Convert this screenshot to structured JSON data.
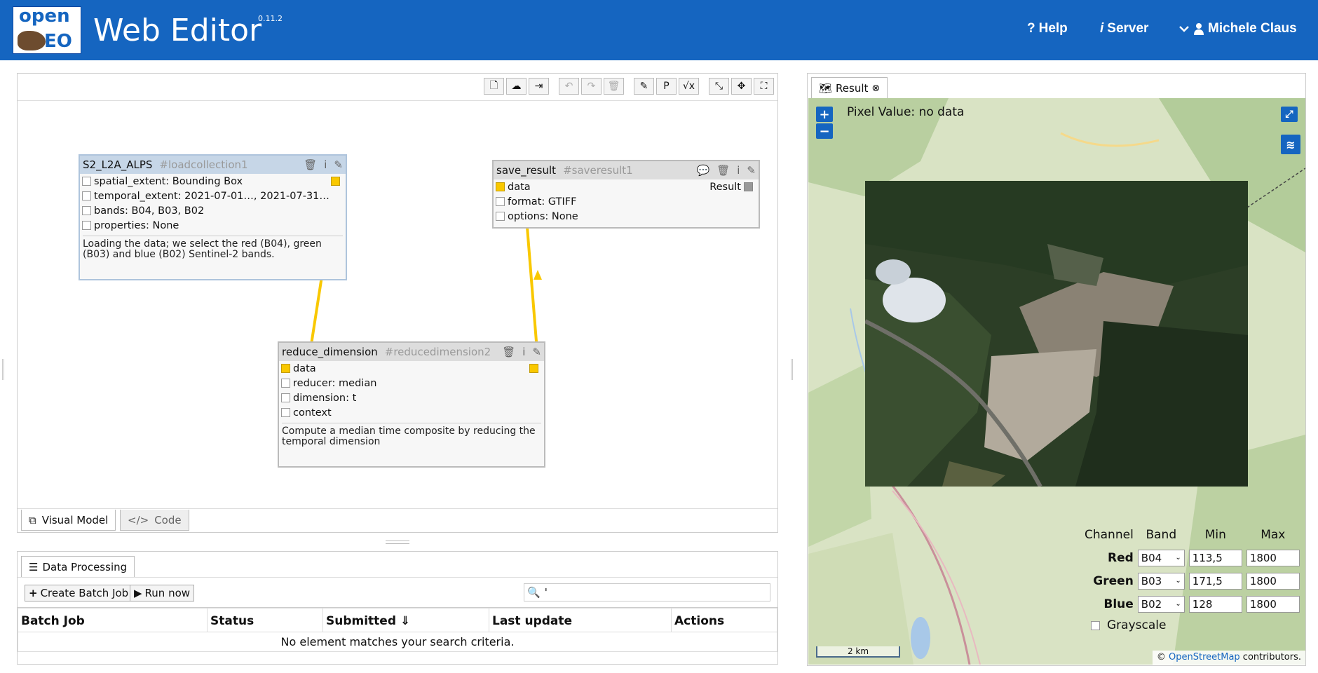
{
  "header": {
    "logo_top": "open",
    "logo_bottom": "EO",
    "title": "Web Editor",
    "version": "0.11.2",
    "help": "Help",
    "server": "Server",
    "user": "Michele Claus"
  },
  "nodes": {
    "load": {
      "name": "S2_L2A_ALPS",
      "id": "#loadcollection1",
      "params": [
        "spatial_extent: Bounding Box",
        "temporal_extent: 2021-07-01…, 2021-07-31…",
        "bands: B04, B03, B02",
        "properties: None"
      ],
      "description": "Loading the data; we select the red (B04), green (B03) and blue (B02) Sentinel-2 bands."
    },
    "save": {
      "name": "save_result",
      "id": "#saveresult1",
      "params": [
        "data",
        "format: GTIFF",
        "options: None"
      ],
      "result_label": "Result"
    },
    "reduce": {
      "name": "reduce_dimension",
      "id": "#reducedimension2",
      "params": [
        "data",
        "reducer: median",
        "dimension: t",
        "context"
      ],
      "description": "Compute a median time composite by reducing the temporal dimension"
    }
  },
  "editor_tabs": {
    "visual": "Visual Model",
    "code": "Code"
  },
  "data_processing": {
    "tab": "Data Processing",
    "create_batch": "Create Batch Job",
    "run_now": "Run now",
    "search_value": "'",
    "columns": [
      "Batch Job",
      "Status",
      "Submitted ⇓",
      "Last update",
      "Actions"
    ],
    "empty_message": "No element matches your search criteria."
  },
  "result": {
    "tab": "Result",
    "pixel_value": "Pixel Value: no data",
    "zoom_in": "+",
    "zoom_out": "−",
    "channels": {
      "headers": [
        "Channel",
        "Band",
        "Min",
        "Max"
      ],
      "rows": [
        {
          "channel": "Red",
          "band": "B04",
          "min": "113,5",
          "max": "1800"
        },
        {
          "channel": "Green",
          "band": "B03",
          "min": "171,5",
          "max": "1800"
        },
        {
          "channel": "Blue",
          "band": "B02",
          "min": "128",
          "max": "1800"
        }
      ],
      "grayscale": "Grayscale"
    },
    "scale": "2 km",
    "attribution_prefix": "© ",
    "attribution_link": "OpenStreetMap",
    "attribution_suffix": " contributors."
  },
  "colors": {
    "header": "#1565c0",
    "port": "#f9c800",
    "edge": "#f9c800"
  }
}
